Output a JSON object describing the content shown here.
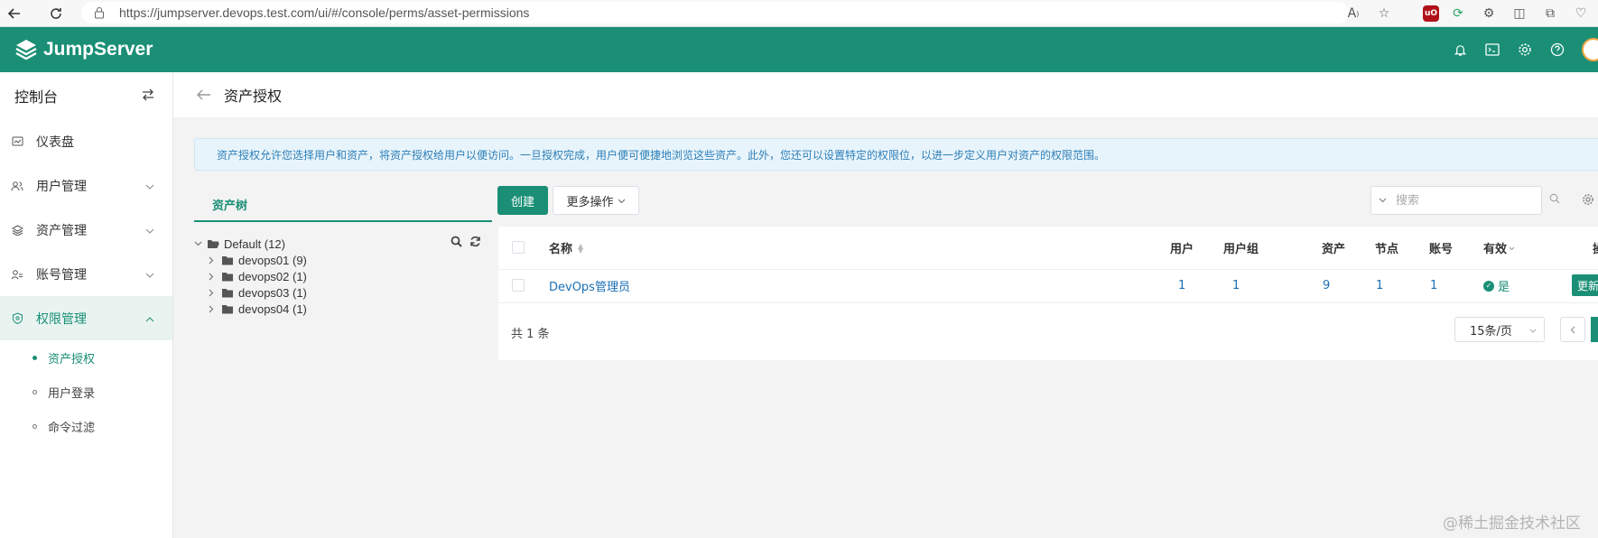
{
  "browser": {
    "url": "https://jumpserver.devops.test.com/ui/#/console/perms/asset-permissions",
    "ext_badge": "uO"
  },
  "app": {
    "logo_text": "JumpServer",
    "header_icons": [
      "bell-icon",
      "terminal-icon",
      "gear-icon",
      "help-icon"
    ],
    "brand_color": "#1a8f76"
  },
  "sidebar": {
    "title": "控制台",
    "items": [
      {
        "label": "仪表盘",
        "icon": "dashboard-icon"
      },
      {
        "label": "用户管理",
        "icon": "users-icon"
      },
      {
        "label": "资产管理",
        "icon": "layers-icon"
      },
      {
        "label": "账号管理",
        "icon": "account-icon"
      },
      {
        "label": "权限管理",
        "icon": "shield-icon"
      }
    ],
    "subitems": [
      {
        "label": "资产授权"
      },
      {
        "label": "用户登录"
      },
      {
        "label": "命令过滤"
      }
    ]
  },
  "page": {
    "title": "资产授权",
    "info": "资产授权允许您选择用户和资产，将资产授权给用户以便访问。一旦授权完成，用户便可便捷地浏览这些资产。此外，您还可以设置特定的权限位，以进一步定义用户对资产的权限范围。"
  },
  "tree": {
    "tab": "资产树",
    "root": "Default (12)",
    "nodes": [
      "devops01 (9)",
      "devops02 (1)",
      "devops03 (1)",
      "devops04 (1)"
    ]
  },
  "toolbar": {
    "create": "创建",
    "more": "更多操作",
    "search_placeholder": "搜索"
  },
  "table": {
    "headers": {
      "name": "名称",
      "users": "用户",
      "user_groups": "用户组",
      "assets": "资产",
      "nodes": "节点",
      "accounts": "账号",
      "valid": "有效",
      "actions": "操"
    },
    "rows": [
      {
        "name": "DevOps管理员",
        "users": "1",
        "user_groups": "1",
        "assets": "9",
        "nodes": "1",
        "accounts": "1",
        "valid": "是",
        "action": "更新"
      }
    ],
    "total": "共 1 条",
    "page_size": "15条/页"
  },
  "watermark": "@稀土掘金技术社区"
}
